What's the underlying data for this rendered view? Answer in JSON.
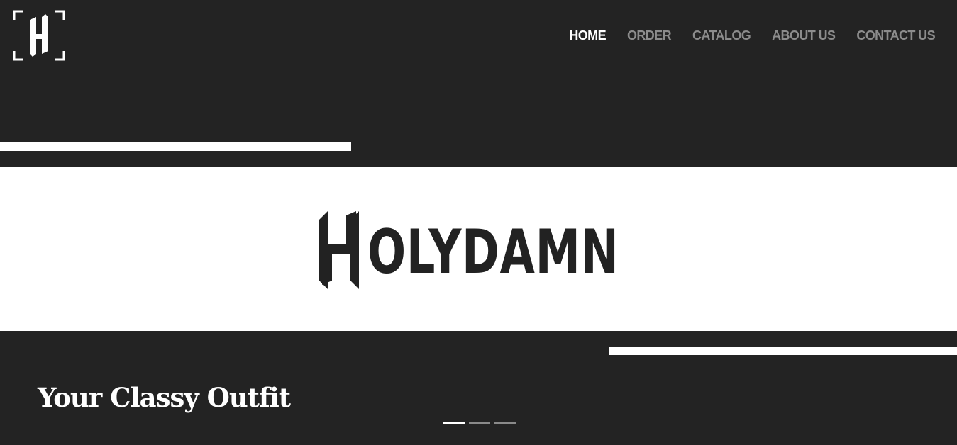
{
  "brand": {
    "logo_icon": "holydamn-h-bracket-logo",
    "wordmark_initial": "H",
    "wordmark_rest": "OLYDAMN"
  },
  "nav": {
    "items": [
      {
        "label": "HOME",
        "active": true
      },
      {
        "label": "ORDER",
        "active": false
      },
      {
        "label": "CATALOG",
        "active": false
      },
      {
        "label": "ABOUT US",
        "active": false
      },
      {
        "label": "CONTACT US",
        "active": false
      }
    ]
  },
  "hero": {
    "tagline": "Your Classy Outfit"
  },
  "slider": {
    "slide_count": 3,
    "active_index": 0
  },
  "colors": {
    "background": "#232323",
    "band": "#ffffff",
    "nav_active": "#ffffff",
    "nav_inactive": "#8c8c8c",
    "wordmark": "#222222"
  }
}
